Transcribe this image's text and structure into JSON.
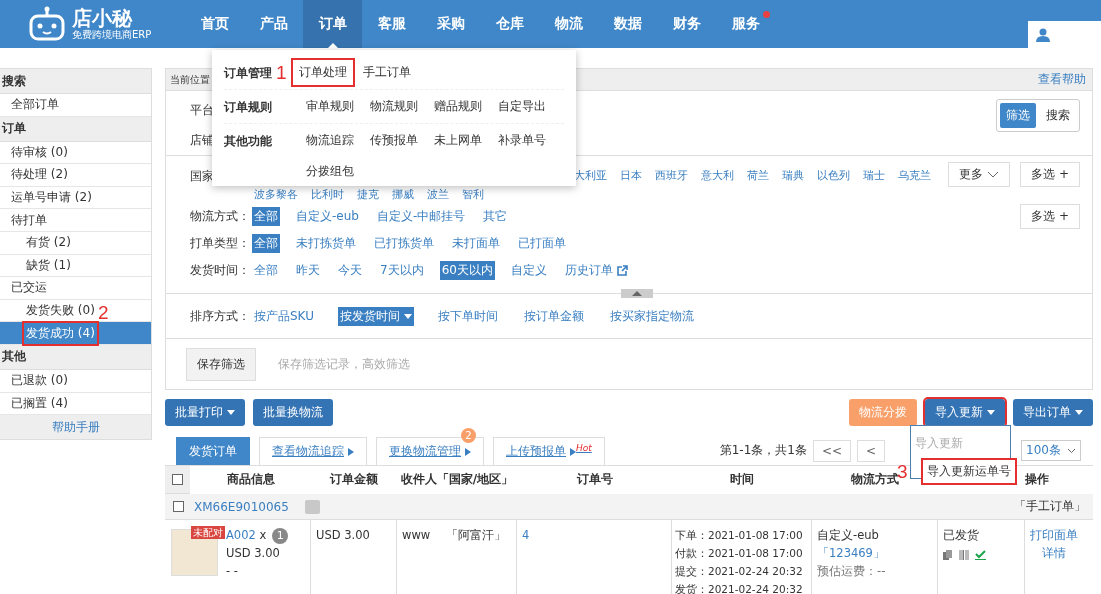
{
  "header": {
    "logo_title": "店小秘",
    "logo_subtitle": "免费跨境电商ERP",
    "nav": [
      {
        "label": "首页",
        "selected": false,
        "notification": false
      },
      {
        "label": "产品",
        "selected": false,
        "notification": false
      },
      {
        "label": "订单",
        "selected": true,
        "notification": false
      },
      {
        "label": "客服",
        "selected": false,
        "notification": false
      },
      {
        "label": "采购",
        "selected": false,
        "notification": false
      },
      {
        "label": "仓库",
        "selected": false,
        "notification": false
      },
      {
        "label": "物流",
        "selected": false,
        "notification": false
      },
      {
        "label": "数据",
        "selected": false,
        "notification": false
      },
      {
        "label": "财务",
        "selected": false,
        "notification": false
      },
      {
        "label": "服务",
        "selected": false,
        "notification": true
      }
    ]
  },
  "order_menu": {
    "groups": [
      {
        "title": "订单管理",
        "links": [
          {
            "label": "订单处理",
            "highlighted": true,
            "annotation": "1"
          },
          {
            "label": "手工订单",
            "highlighted": false
          }
        ]
      },
      {
        "title": "订单规则",
        "links": [
          {
            "label": "审单规则",
            "highlighted": false
          },
          {
            "label": "物流规则",
            "highlighted": false
          },
          {
            "label": "赠品规则",
            "highlighted": false
          },
          {
            "label": "自定导出",
            "highlighted": false
          }
        ]
      },
      {
        "title": "其他功能",
        "links": [
          {
            "label": "物流追踪",
            "highlighted": false
          },
          {
            "label": "传预报单",
            "highlighted": false
          },
          {
            "label": "未上网单",
            "highlighted": false
          },
          {
            "label": "补录单号",
            "highlighted": false
          },
          {
            "label": "分拨组包",
            "highlighted": false
          }
        ]
      }
    ]
  },
  "sidebar": {
    "sections": [
      {
        "title": "搜索",
        "items": [
          {
            "label": "全部订单",
            "selected": false
          }
        ]
      },
      {
        "title": "订单",
        "items": [
          {
            "label": "待审核 (0)",
            "selected": false
          },
          {
            "label": "待处理 (2)",
            "selected": false
          },
          {
            "label": "运单号申请 (2)",
            "selected": false
          },
          {
            "label": "待打单",
            "selected": false,
            "children": [
              {
                "label": "有货 (2)",
                "selected": false
              },
              {
                "label": "缺货 (1)",
                "selected": false
              }
            ]
          },
          {
            "label": "已交运",
            "selected": false,
            "children": [
              {
                "label": "发货失败 (0)",
                "selected": false
              },
              {
                "label": "发货成功 (4)",
                "selected": true,
                "highlighted": true,
                "annotation": "2"
              }
            ]
          }
        ]
      },
      {
        "title": "其他",
        "items": [
          {
            "label": "已退款 (0)",
            "selected": false
          },
          {
            "label": "已搁置 (4)",
            "selected": false
          }
        ]
      }
    ],
    "help": "帮助手册"
  },
  "breadcrumb": {
    "label": "当前位置",
    "help": "查看帮助"
  },
  "filters": {
    "platform_label": "平台",
    "shop_label": "店铺",
    "mode_toggle": [
      {
        "label": "筛选",
        "selected": true
      },
      {
        "label": "搜索",
        "selected": false
      }
    ],
    "country": {
      "label": "国家",
      "options": [
        "大利亚",
        "日本",
        "西班牙",
        "意大利",
        "荷兰",
        "瑞典",
        "以色列",
        "瑞士",
        "乌克兰"
      ],
      "options_line_2": [
        "波多黎各",
        "比利时",
        "捷克",
        "挪威",
        "波兰",
        "智利"
      ],
      "more": "更多",
      "multi": "多选 +"
    },
    "rows": [
      {
        "label": "物流方式：",
        "multi": "多选 +",
        "options": [
          {
            "label": "全部",
            "selected": true,
            "external": false
          },
          {
            "label": "自定义-eub",
            "selected": false,
            "external": false
          },
          {
            "label": "自定义-中邮挂号",
            "selected": false,
            "external": false
          },
          {
            "label": "其它",
            "selected": false,
            "external": false
          }
        ]
      },
      {
        "label": "打单类型：",
        "options": [
          {
            "label": "全部",
            "selected": true,
            "external": false
          },
          {
            "label": "未打拣货单",
            "selected": false,
            "external": false
          },
          {
            "label": "已打拣货单",
            "selected": false,
            "external": false
          },
          {
            "label": "未打面单",
            "selected": false,
            "external": false
          },
          {
            "label": "已打面单",
            "selected": false,
            "external": false
          }
        ]
      },
      {
        "label": "发货时间：",
        "options": [
          {
            "label": "全部",
            "selected": false,
            "external": false
          },
          {
            "label": "昨天",
            "selected": false,
            "external": false
          },
          {
            "label": "今天",
            "selected": false,
            "external": false
          },
          {
            "label": "7天以内",
            "selected": false,
            "external": false
          },
          {
            "label": "60天以内",
            "selected": true,
            "external": false
          },
          {
            "label": "自定义",
            "selected": false,
            "external": false
          },
          {
            "label": "历史订单",
            "selected": false,
            "external": true
          }
        ]
      }
    ],
    "sort": {
      "label": "排序方式：",
      "options": [
        {
          "label": "按产品SKU",
          "selected": false
        },
        {
          "label": "按发货时间",
          "selected": true
        },
        {
          "label": "按下单时间",
          "selected": false
        },
        {
          "label": "按订单金额",
          "selected": false
        },
        {
          "label": "按买家指定物流",
          "selected": false
        }
      ]
    },
    "save_button": "保存筛选",
    "save_hint": "保存筛选记录，高效筛选"
  },
  "actions": {
    "left": [
      {
        "label": "批量打印",
        "kind": "primary",
        "dropdown": true,
        "highlighted": false
      },
      {
        "label": "批量换物流",
        "kind": "primary",
        "dropdown": false,
        "highlighted": false
      }
    ],
    "right": [
      {
        "label": "物流分拨",
        "kind": "warning",
        "dropdown": false,
        "highlighted": false
      },
      {
        "label": "导入更新",
        "kind": "primary",
        "dropdown": true,
        "highlighted": true
      },
      {
        "label": "导出订单",
        "kind": "primary",
        "dropdown": true,
        "highlighted": false
      }
    ]
  },
  "import_menu": {
    "items": [
      {
        "label": "导入更新",
        "disabled": true,
        "highlighted": false
      },
      {
        "label": "导入更新运单号",
        "disabled": false,
        "highlighted": true,
        "annotation": "3"
      }
    ]
  },
  "tabs": [
    {
      "label": "发货订单",
      "selected": true
    },
    {
      "label": "查看物流追踪",
      "selected": false
    },
    {
      "label": "更换物流管理",
      "selected": false,
      "badge": "2"
    },
    {
      "label": "上传预报单",
      "selected": false,
      "tag": "Hot"
    }
  ],
  "pager": {
    "summary": "第1-1条，共1条",
    "buttons": [
      "<<",
      "<"
    ],
    "page_size": "100条"
  },
  "table": {
    "header_checked": false,
    "columns": [
      "商品信息",
      "订单金额",
      "收件人「国家/地区」",
      "订单号",
      "时间",
      "物流方式",
      "操作"
    ],
    "groups": [
      {
        "checked": false,
        "order_id": "XM66E9010065",
        "source": "「手工订单」",
        "rows": [
          {
            "tag": "未配对",
            "sku": "A002",
            "qty_sep": "x",
            "qty": "1",
            "price": "USD 3.00",
            "extra": "- -",
            "amount": "USD 3.00",
            "recipient": "www",
            "country": "「阿富汗」",
            "order_no": "4",
            "times": [
              "下单：2021-01-08 17:00",
              "付款：2021-01-08 17:00",
              "提交：2021-02-24 20:32",
              "发货：2021-02-24 20:32"
            ],
            "logistics": "自定义-eub",
            "tracking": "「123469」",
            "shipping_estimate": "预估运费：--",
            "status": "已发货",
            "operations": [
              "打印面单",
              "详情"
            ]
          }
        ]
      }
    ]
  }
}
